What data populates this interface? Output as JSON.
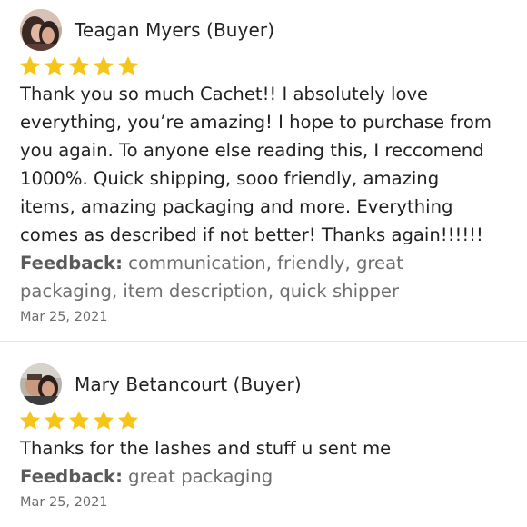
{
  "reviews": [
    {
      "reviewer": "Teagan Myers (Buyer)",
      "rating": 5,
      "text_lines": [
        "Thank you so much Cachet!! I absolutely love",
        "everything, you’re amazing! I hope to purchase from",
        "you again. To anyone else reading this, I reccomend",
        "1000%. Quick shipping, sooo friendly, amazing",
        "items, amazing packaging and more. Everything",
        "comes as described if not better! Thanks again!!!!!!"
      ],
      "feedback_label": "Feedback:",
      "feedback_lines": [
        " communication, friendly, great",
        "packaging, item description, quick shipper"
      ],
      "date": "Mar 25, 2021"
    },
    {
      "reviewer": "Mary Betancourt (Buyer)",
      "rating": 5,
      "text_lines": [
        "Thanks for the lashes and stuff u sent me"
      ],
      "feedback_label": "Feedback:",
      "feedback_lines": [
        " great packaging"
      ],
      "date": "Mar 25, 2021"
    }
  ],
  "colors": {
    "star": "#f5c518",
    "divider": "#e6e6e6"
  },
  "icons": {
    "star": "star-icon",
    "avatar": "avatar"
  }
}
